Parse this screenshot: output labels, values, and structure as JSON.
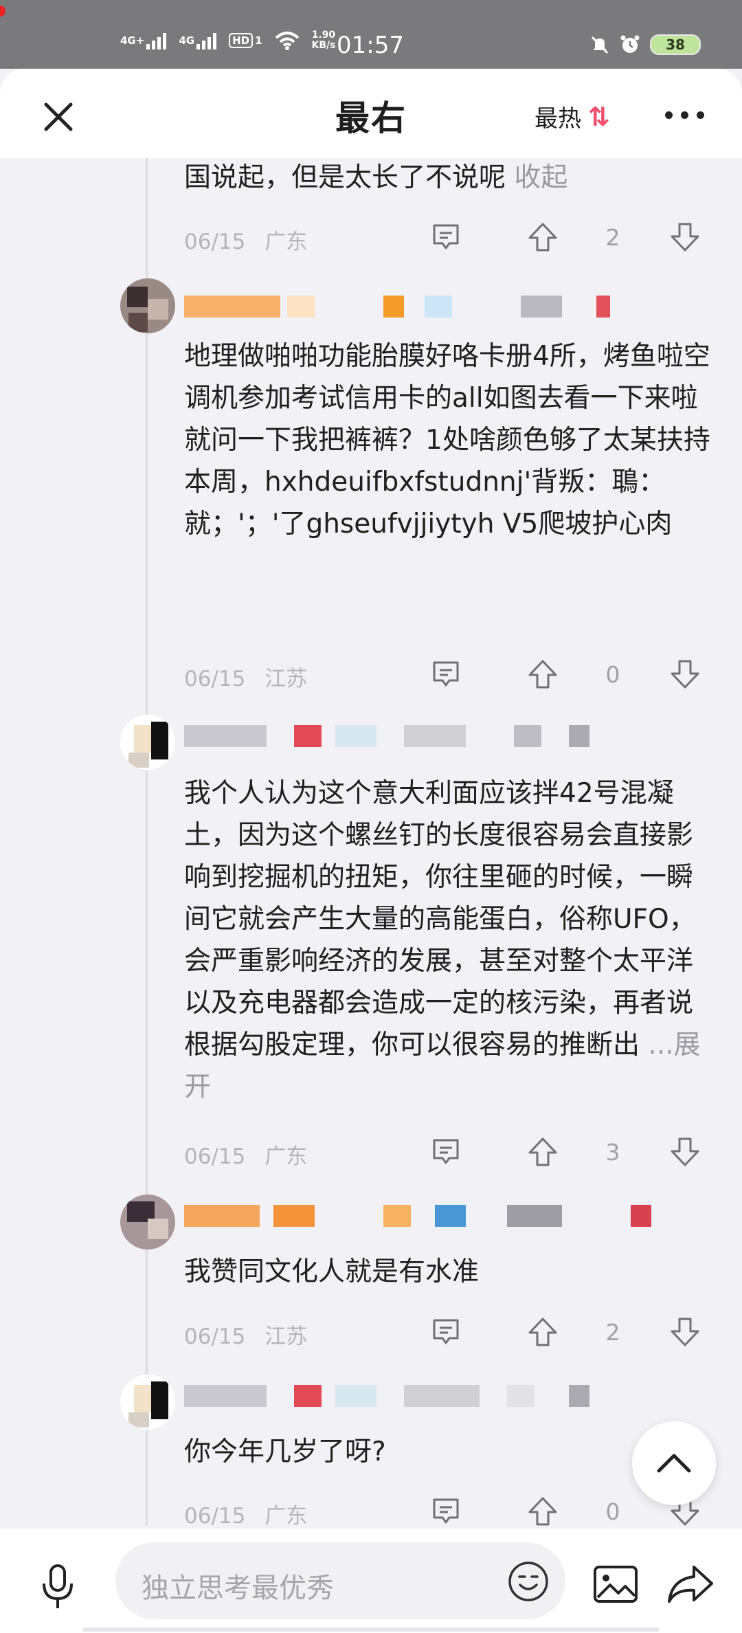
{
  "status_bar": {
    "net1": "4G+",
    "net2": "4G",
    "hd": "HD",
    "hd_sub": "1",
    "speed_value": "1.90",
    "speed_unit": "KB/s",
    "time": "01:57",
    "battery": "38"
  },
  "header": {
    "title": "最右",
    "sort_label": "最热",
    "sort_icon": "⇅"
  },
  "comments": [
    {
      "text": "国说起，但是太长了不说呢",
      "toggle": "收起",
      "date": "06/15",
      "location": "广东",
      "votes": "2"
    },
    {
      "text": "地理做啪啪功能胎膜好咯卡册4所，烤鱼啦空调机参加考试信用卡的all如图去看一下来啦就问一下我把裤裤？1处啥颜色够了太某扶持本周，hxhdeuifbxfstudnnj'背叛：鵈：就；'；'了ghseufvjjiytyh  V5爬坡护心肉",
      "date": "06/15",
      "location": "江苏",
      "votes": "0"
    },
    {
      "text": "我个人认为这个意大利面应该拌42号混凝土，因为这个螺丝钉的长度很容易会直接影响到挖掘机的扭矩，你往里砸的时候，一瞬间它就会产生大量的高能蛋白，俗称UFO，会严重影响经济的发展，甚至对整个太平洋以及充电器都会造成一定的核污染，再者说根据勾股定理，你可以很容易的推断出",
      "toggle": "...展开",
      "date": "06/15",
      "location": "广东",
      "votes": "3"
    },
    {
      "text": "我赞同文化人就是有水准",
      "date": "06/15",
      "location": "江苏",
      "votes": "2"
    },
    {
      "text": "你今年几岁了呀?",
      "date": "06/15",
      "location": "广东",
      "votes": "0"
    }
  ],
  "bottom_bar": {
    "input_placeholder": "独立思考最优秀"
  },
  "colors": {
    "accent": "#f0506e",
    "meta_text": "#b4b4ba",
    "thread_line": "#dcdce2"
  },
  "icons": [
    "close-icon",
    "sort-icon",
    "more-icon",
    "comment-icon",
    "upvote-icon",
    "downvote-icon",
    "scroll-top-icon",
    "mic-icon",
    "emoji-icon",
    "image-icon",
    "share-icon"
  ]
}
